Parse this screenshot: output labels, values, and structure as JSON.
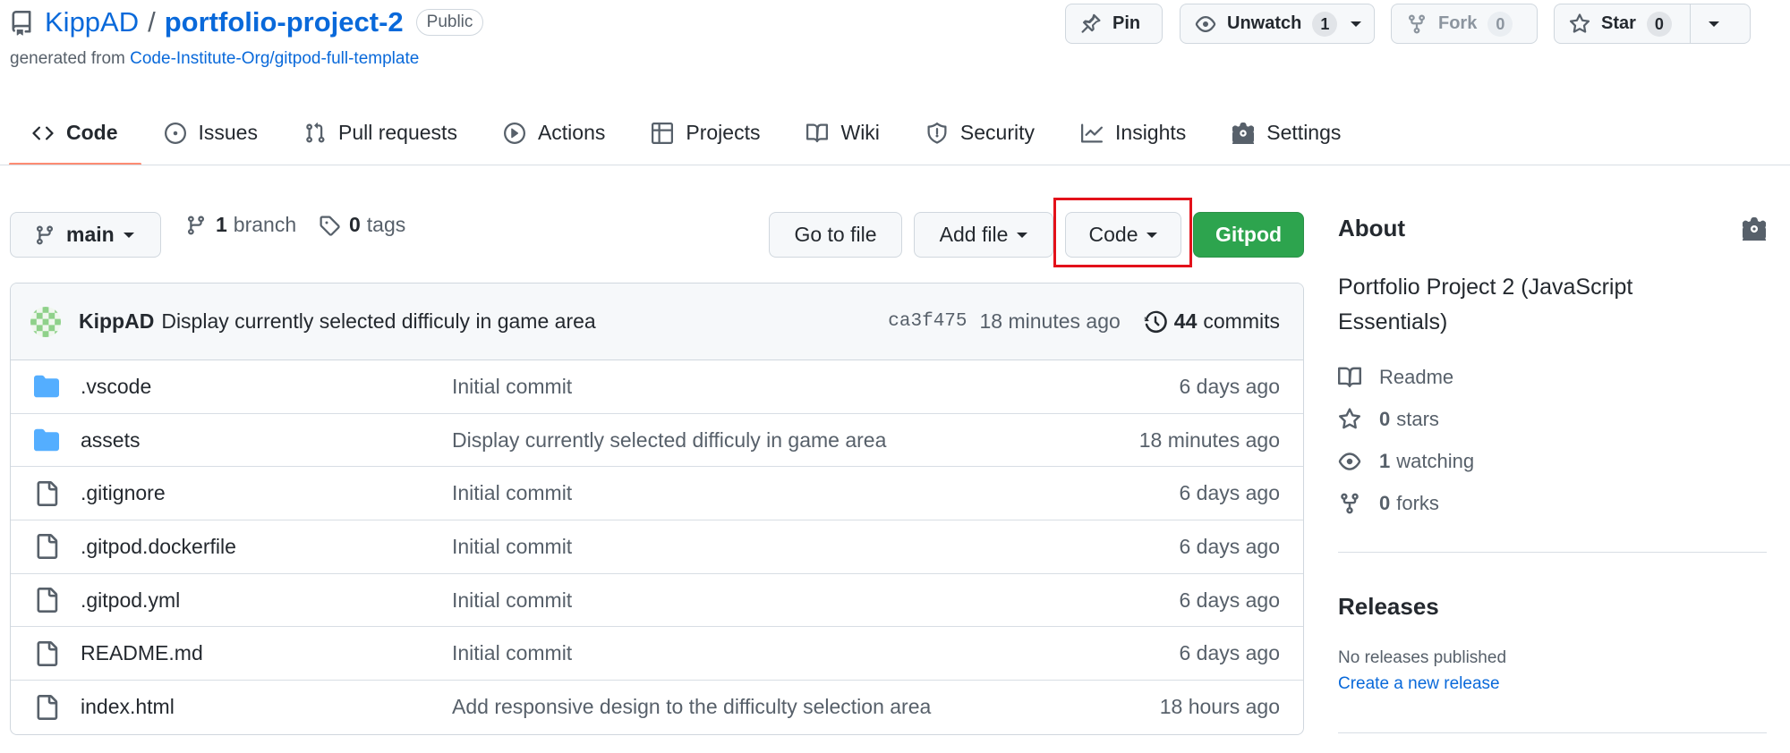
{
  "header": {
    "owner": "KippAD",
    "separator": "/",
    "repo_name": "portfolio-project-2",
    "visibility": "Public",
    "generated_prefix": "generated from",
    "template": "Code-Institute-Org/gitpod-full-template",
    "pin_label": "Pin",
    "unwatch_label": "Unwatch",
    "unwatch_count": "1",
    "fork_label": "Fork",
    "fork_count": "0",
    "star_label": "Star",
    "star_count": "0"
  },
  "tabs": [
    {
      "label": "Code",
      "icon": "code-icon",
      "active": true
    },
    {
      "label": "Issues",
      "icon": "issue-icon"
    },
    {
      "label": "Pull requests",
      "icon": "pull-request-icon"
    },
    {
      "label": "Actions",
      "icon": "play-icon"
    },
    {
      "label": "Projects",
      "icon": "table-icon"
    },
    {
      "label": "Wiki",
      "icon": "book-icon"
    },
    {
      "label": "Security",
      "icon": "shield-icon"
    },
    {
      "label": "Insights",
      "icon": "graph-icon"
    },
    {
      "label": "Settings",
      "icon": "gear-icon"
    }
  ],
  "branchbar": {
    "branch": "main",
    "branch_count": "1",
    "branch_label": "branch",
    "tag_count": "0",
    "tag_label": "tags",
    "goto_file": "Go to file",
    "add_file": "Add file",
    "code": "Code",
    "gitpod": "Gitpod"
  },
  "latest_commit": {
    "author": "KippAD",
    "message": "Display currently selected difficuly in game area",
    "sha": "ca3f475",
    "age": "18 minutes ago",
    "commit_count": "44",
    "commits_label": "commits"
  },
  "files": [
    {
      "type": "folder",
      "name": ".vscode",
      "message": "Initial commit",
      "age": "6 days ago"
    },
    {
      "type": "folder",
      "name": "assets",
      "message": "Display currently selected difficuly in game area",
      "age": "18 minutes ago"
    },
    {
      "type": "file",
      "name": ".gitignore",
      "message": "Initial commit",
      "age": "6 days ago"
    },
    {
      "type": "file",
      "name": ".gitpod.dockerfile",
      "message": "Initial commit",
      "age": "6 days ago"
    },
    {
      "type": "file",
      "name": ".gitpod.yml",
      "message": "Initial commit",
      "age": "6 days ago"
    },
    {
      "type": "file",
      "name": "README.md",
      "message": "Initial commit",
      "age": "6 days ago"
    },
    {
      "type": "file",
      "name": "index.html",
      "message": "Add responsive design to the difficulty selection area",
      "age": "18 hours ago"
    }
  ],
  "about": {
    "heading": "About",
    "description": "Portfolio Project 2 (JavaScript Essentials)",
    "readme": "Readme",
    "stars_count": "0",
    "stars_label": "stars",
    "watching_count": "1",
    "watching_label": "watching",
    "forks_count": "0",
    "forks_label": "forks"
  },
  "releases": {
    "heading": "Releases",
    "none_text": "No releases published",
    "create_link": "Create a new release"
  },
  "colors": {
    "link": "#0969da",
    "gitpod_green": "#2da44e",
    "folder_blue": "#54aeff",
    "tab_underline": "#fd8c73",
    "highlight_red": "#e3111a"
  }
}
